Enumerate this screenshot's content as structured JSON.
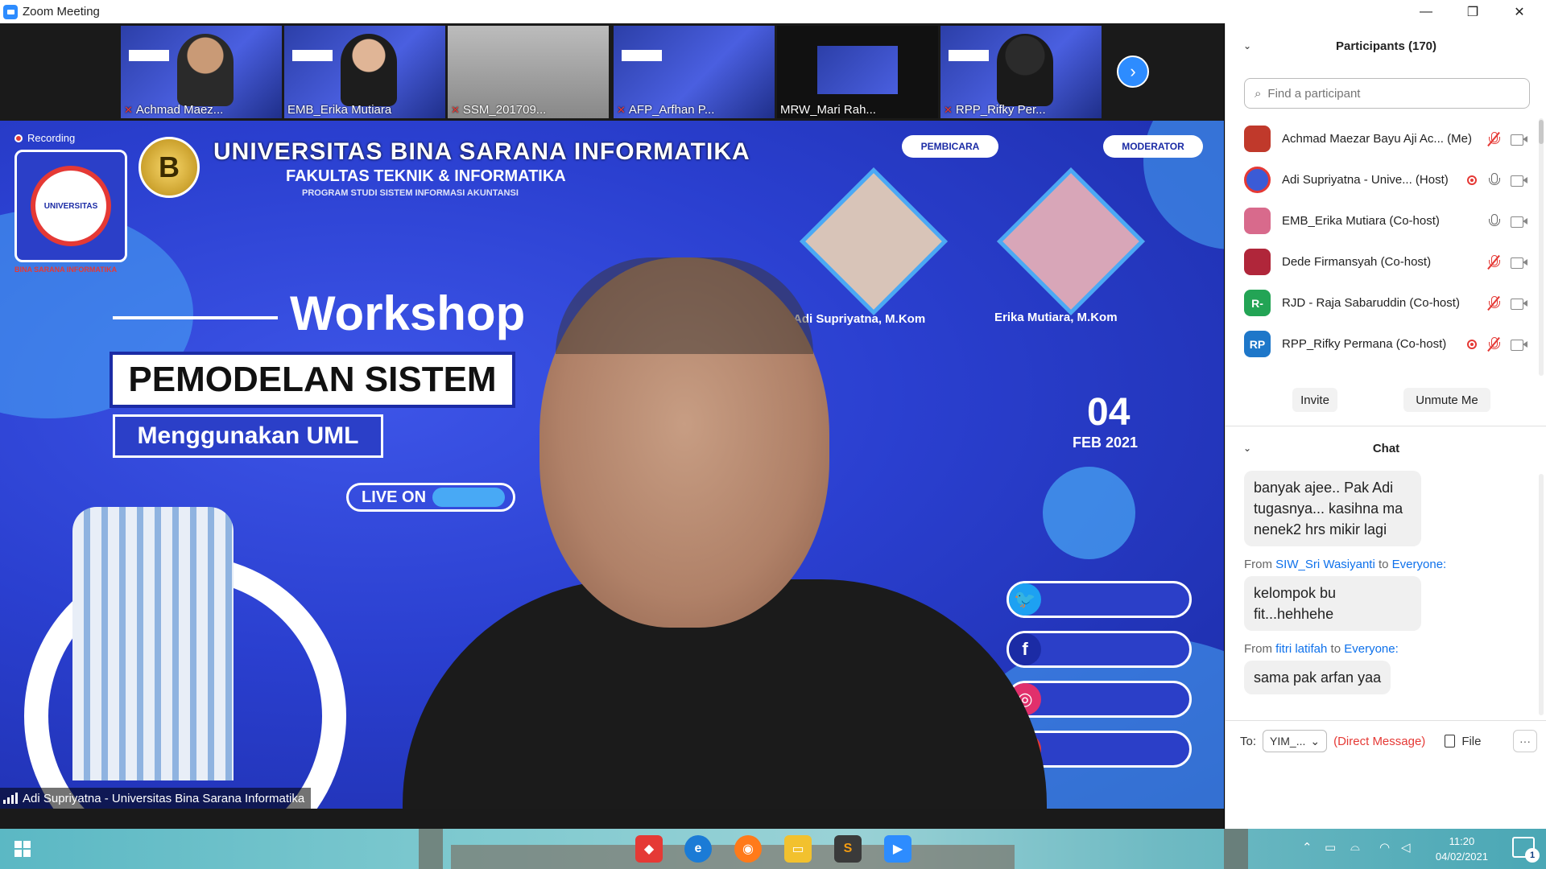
{
  "window": {
    "title": "Zoom Meeting",
    "minimize": "—",
    "maximize": "❐",
    "close": "✕"
  },
  "thumbnails": [
    {
      "name": "Achmad Maez...",
      "muted": true
    },
    {
      "name": "EMB_Erika Mutiara",
      "muted": false
    },
    {
      "name": "SSM_201709...",
      "muted": true
    },
    {
      "name": "AFP_Arfhan P...",
      "muted": true
    },
    {
      "name": "MRW_Mari Rah...",
      "muted": false
    },
    {
      "name": "RPP_Rifky Per...",
      "muted": true
    }
  ],
  "stage": {
    "recording_label": "Recording",
    "university": "UNIVERSITAS BINA SARANA INFORMATIKA",
    "faculty": "FAKULTAS TEKNIK & INFORMATIKA",
    "program": "PROGRAM STUDI SISTEM INFORMASI AKUNTANSI",
    "workshop": "Workshop",
    "topic": "PEMODELAN SISTEM",
    "subtopic": "Menggunakan UML",
    "live_on": "LIVE ON",
    "date_day": "04",
    "date_month": "FEB 2021",
    "speaker1_tag": "PEMBICARA",
    "speaker2_tag": "MODERATOR",
    "speaker1": "Adi Supriyatna, M.Kom",
    "speaker2": "Erika Mutiara, M.Kom",
    "logo_badge": "B",
    "logo_text": "UNIVERSITAS",
    "logo_caption": "BINA SARANA INFORMATIKA",
    "active_speaker_label": "Adi Supriyatna - Universitas Bina Sarana Informatika"
  },
  "participants": {
    "title": "Participants (170)",
    "search_placeholder": "Find a participant",
    "list": [
      {
        "initials": "",
        "name": "Achmad Maezar Bayu Aji Ac...",
        "role": "(Me)",
        "avatar_color": "#c0392b",
        "recording": false,
        "muted": true
      },
      {
        "initials": "",
        "name": "Adi Supriyatna - Unive...",
        "role": "(Host)",
        "avatar_color": "#3b5bd6",
        "recording": true,
        "muted": false
      },
      {
        "initials": "",
        "name": "EMB_Erika Mutiara",
        "role": "(Co-host)",
        "avatar_color": "#d86a8c",
        "recording": false,
        "muted": false
      },
      {
        "initials": "",
        "name": "Dede Firmansyah",
        "role": "(Co-host)",
        "avatar_color": "#b0263a",
        "recording": false,
        "muted": true
      },
      {
        "initials": "R-",
        "name": "RJD - Raja Sabaruddin",
        "role": "(Co-host)",
        "avatar_color": "#23a455",
        "recording": false,
        "muted": true
      },
      {
        "initials": "RP",
        "name": "RPP_Rifky Permana",
        "role": "(Co-host)",
        "avatar_color": "#1e77c9",
        "recording": true,
        "muted": true
      }
    ],
    "invite_label": "Invite",
    "unmute_label": "Unmute Me"
  },
  "chat": {
    "title": "Chat",
    "messages": [
      {
        "from": "",
        "to": "",
        "text": "banyak ajee.. Pak Adi tugasnya... kasihna ma nenek2  hrs mikir lagi"
      },
      {
        "from": "SIW_Sri Wasiyanti",
        "to": "Everyone:",
        "text": "kelompok bu fit...hehhehe"
      },
      {
        "from": "fitri latifah",
        "to": "Everyone:",
        "text": "sama pak arfan yaa"
      }
    ],
    "from_word": "From",
    "to_word": "to",
    "to_label": "To:",
    "recipient": "YIM_...",
    "direct_message": "(Direct Message)",
    "file_label": "File",
    "more_label": "···"
  },
  "taskbar": {
    "time": "11:20",
    "date": "04/02/2021",
    "notifications": "1"
  },
  "colors": {
    "zoom_blue": "#2d8cff",
    "muted_red": "#e53935",
    "link_blue": "#0e71eb"
  }
}
